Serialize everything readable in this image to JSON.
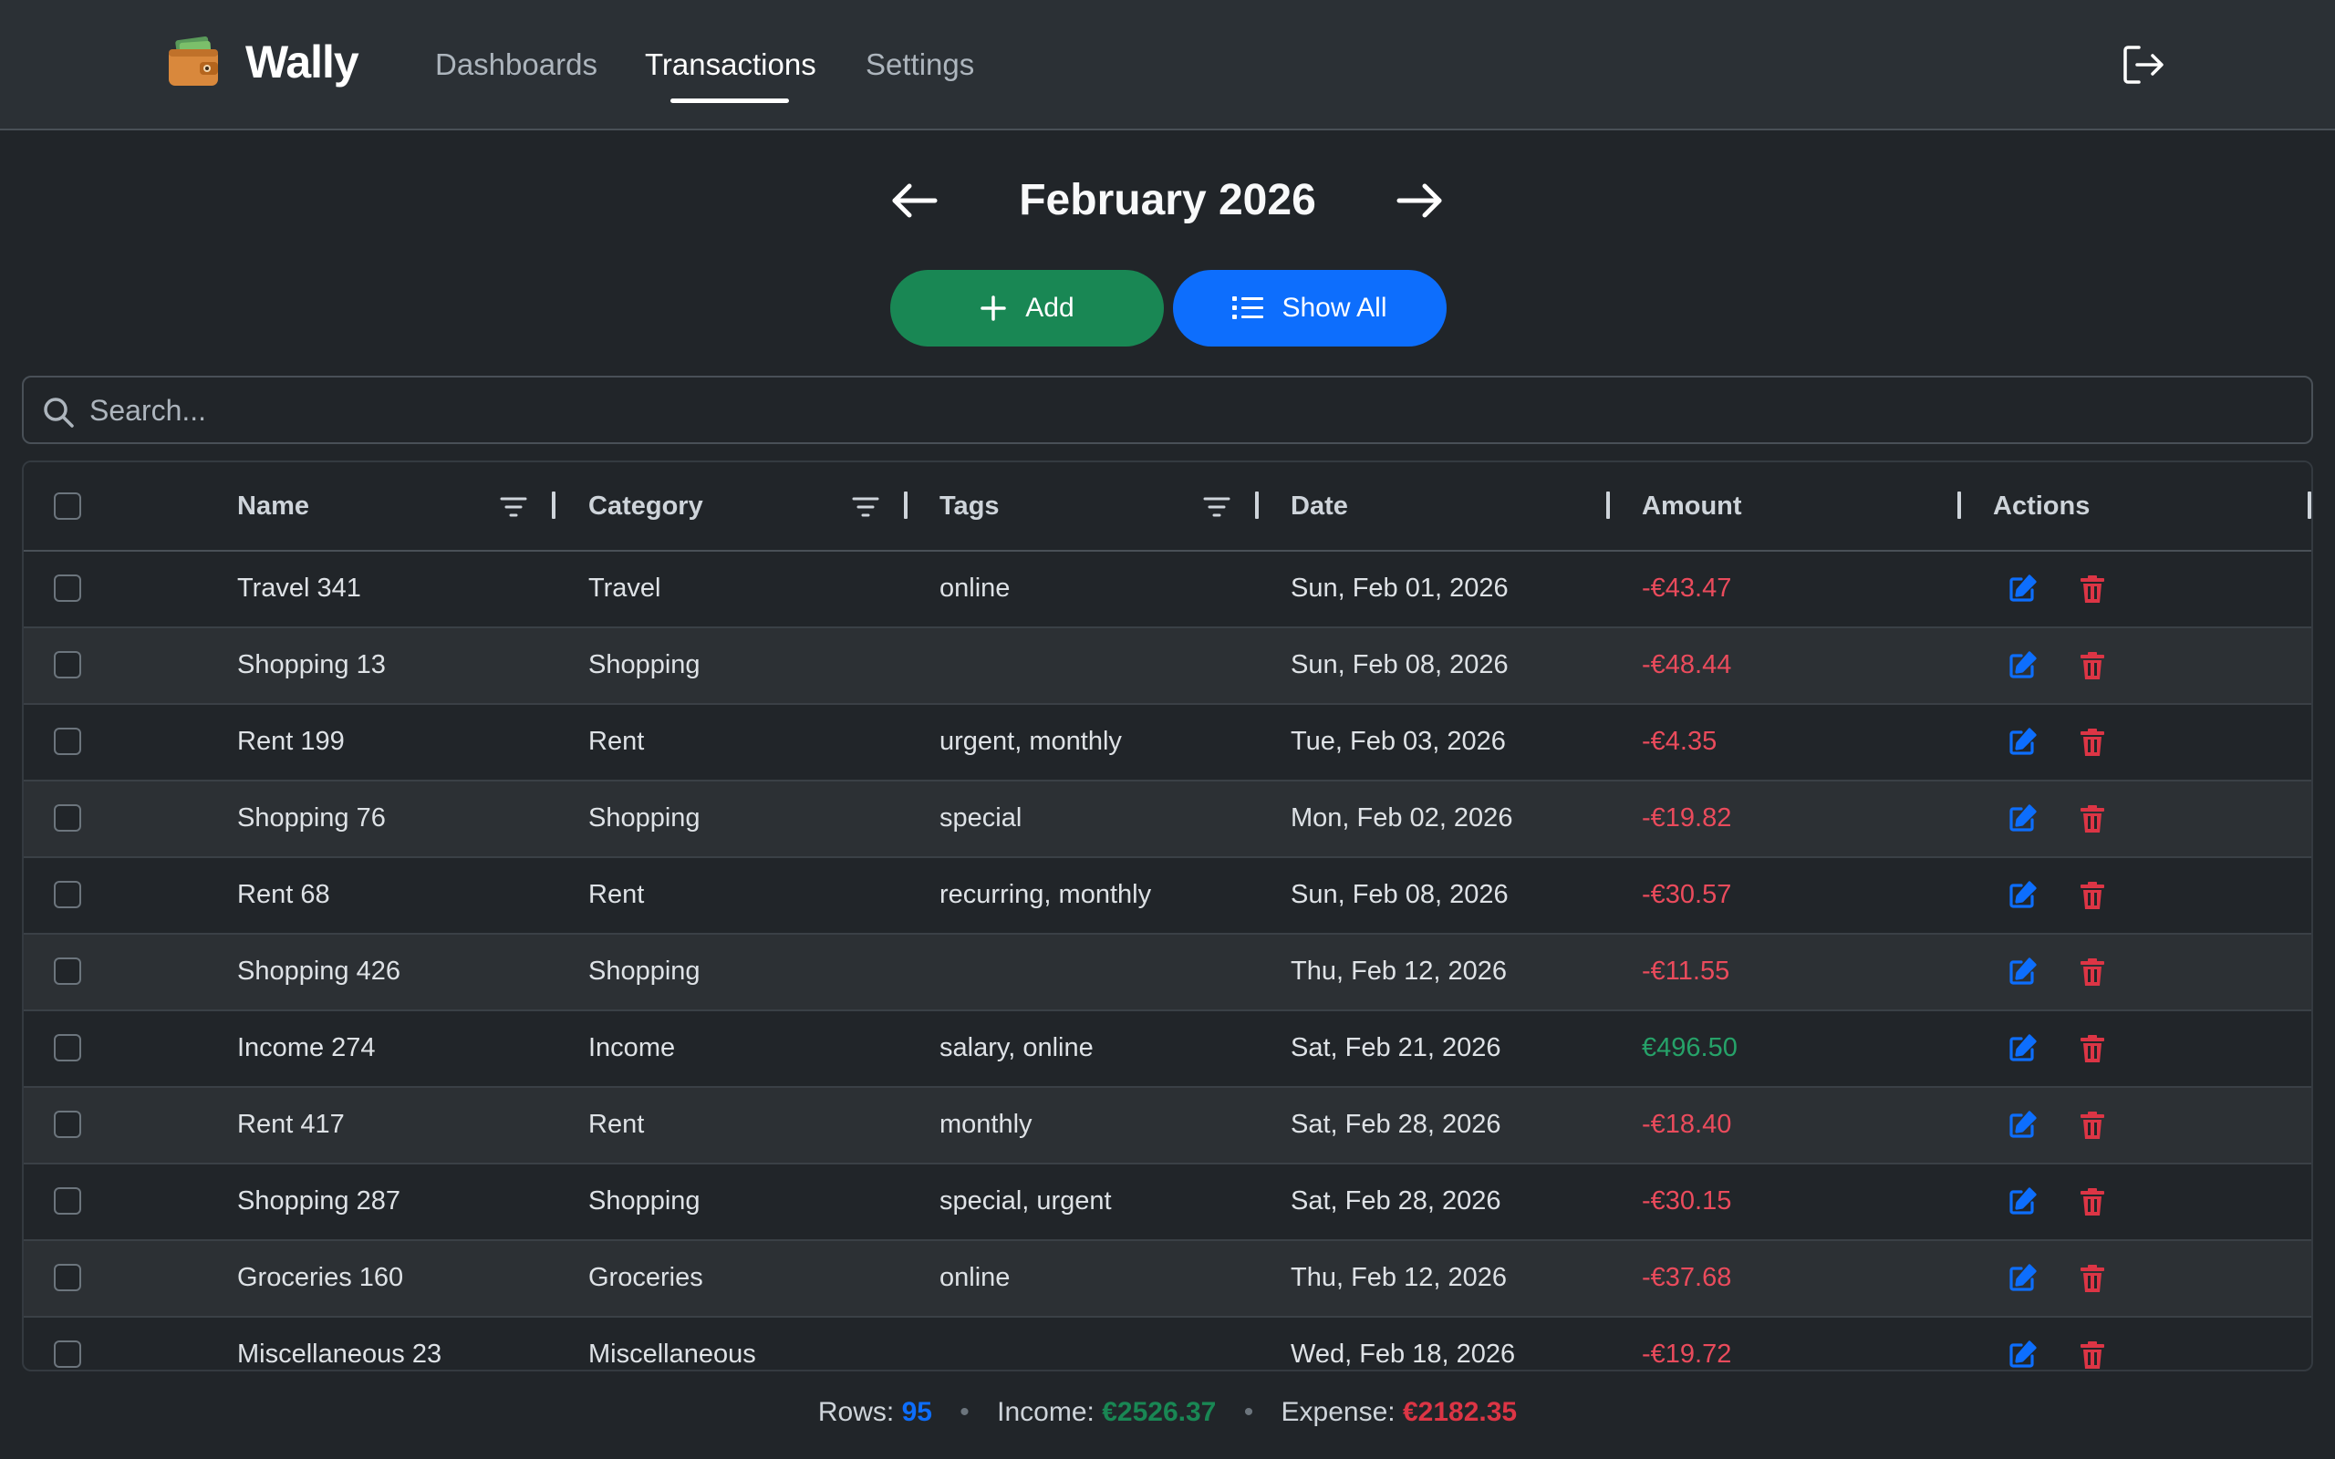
{
  "app": {
    "name": "Wally"
  },
  "nav": {
    "items": [
      {
        "label": "Dashboards"
      },
      {
        "label": "Transactions",
        "active": true
      },
      {
        "label": "Settings"
      }
    ]
  },
  "month": {
    "title": "February 2026"
  },
  "buttons": {
    "add": "Add",
    "show_all": "Show All"
  },
  "search": {
    "placeholder": "Search...",
    "value": ""
  },
  "table": {
    "columns": [
      "Name",
      "Category",
      "Tags",
      "Date",
      "Amount",
      "Actions"
    ],
    "rows": [
      {
        "name": "Travel 341",
        "category": "Travel",
        "tags": "online",
        "date": "Sun, Feb 01, 2026",
        "amount": "-€43.47"
      },
      {
        "name": "Shopping 13",
        "category": "Shopping",
        "tags": "",
        "date": "Sun, Feb 08, 2026",
        "amount": "-€48.44"
      },
      {
        "name": "Rent 199",
        "category": "Rent",
        "tags": "urgent, monthly",
        "date": "Tue, Feb 03, 2026",
        "amount": "-€4.35"
      },
      {
        "name": "Shopping 76",
        "category": "Shopping",
        "tags": "special",
        "date": "Mon, Feb 02, 2026",
        "amount": "-€19.82"
      },
      {
        "name": "Rent 68",
        "category": "Rent",
        "tags": "recurring, monthly",
        "date": "Sun, Feb 08, 2026",
        "amount": "-€30.57"
      },
      {
        "name": "Shopping 426",
        "category": "Shopping",
        "tags": "",
        "date": "Thu, Feb 12, 2026",
        "amount": "-€11.55"
      },
      {
        "name": "Income 274",
        "category": "Income",
        "tags": "salary, online",
        "date": "Sat, Feb 21, 2026",
        "amount": "€496.50"
      },
      {
        "name": "Rent 417",
        "category": "Rent",
        "tags": "monthly",
        "date": "Sat, Feb 28, 2026",
        "amount": "-€18.40"
      },
      {
        "name": "Shopping 287",
        "category": "Shopping",
        "tags": "special, urgent",
        "date": "Sat, Feb 28, 2026",
        "amount": "-€30.15"
      },
      {
        "name": "Groceries 160",
        "category": "Groceries",
        "tags": "online",
        "date": "Thu, Feb 12, 2026",
        "amount": "-€37.68"
      },
      {
        "name": "Miscellaneous 23",
        "category": "Miscellaneous",
        "tags": "",
        "date": "Wed, Feb 18, 2026",
        "amount": "-€19.72"
      }
    ]
  },
  "summary": {
    "rows_label": "Rows:",
    "rows_value": "95",
    "income_label": "Income:",
    "income_value": "€2526.37",
    "expense_label": "Expense:",
    "expense_value": "€2182.35",
    "separator": "•"
  },
  "colors": {
    "background": "#212529",
    "navbar": "#2b3035",
    "add_button": "#198754",
    "show_all_button": "#0d6efd",
    "negative": "#ea4b5c",
    "positive": "#26a269",
    "edit_icon": "#0d6efd",
    "delete_icon": "#dc3545"
  },
  "icons": [
    "wallet-icon",
    "logout-icon",
    "arrow-left-icon",
    "arrow-right-icon",
    "plus-icon",
    "list-icon",
    "search-icon",
    "filter-icon",
    "edit-icon",
    "trash-icon"
  ]
}
